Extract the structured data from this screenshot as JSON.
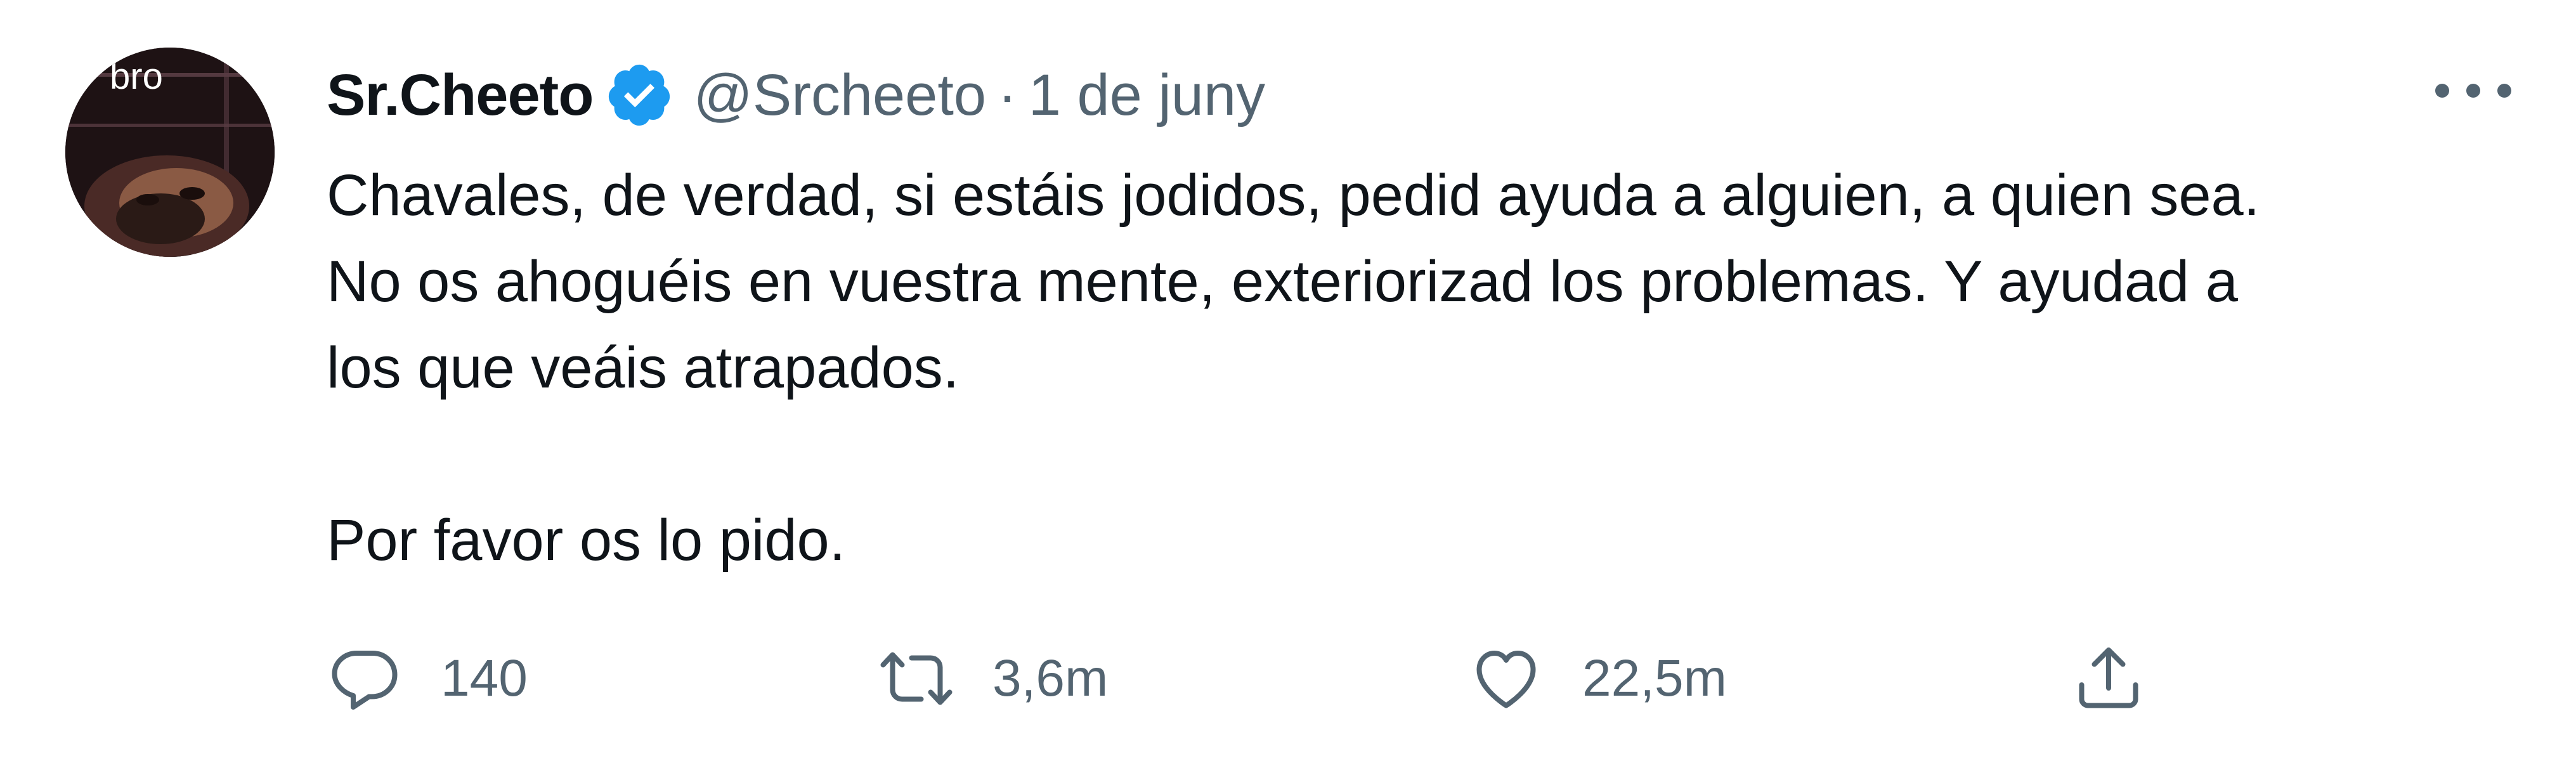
{
  "tweet": {
    "avatar_caption": "bro",
    "display_name": "Sr.Cheeto",
    "handle": "@Srcheeto",
    "separator": "·",
    "date": "1 de juny",
    "text": "Chavales, de verdad, si estáis jodidos, pedid ayuda a alguien, a quien sea.\nNo os ahoguéis en vuestra mente, exteriorizad los problemas. Y ayudad a\nlos que veáis atrapados.\n\nPor favor os lo pido.",
    "replies": "140",
    "retweets": "3,6m",
    "likes": "22,5m"
  },
  "icons": {
    "verified": "verified-badge-icon",
    "more": "more-options-icon",
    "reply": "reply-icon",
    "retweet": "retweet-icon",
    "like": "heart-icon",
    "share": "share-icon"
  },
  "colors": {
    "verified_blue": "#1d9bf0",
    "text_primary": "#0f1419",
    "text_secondary": "#536471"
  }
}
